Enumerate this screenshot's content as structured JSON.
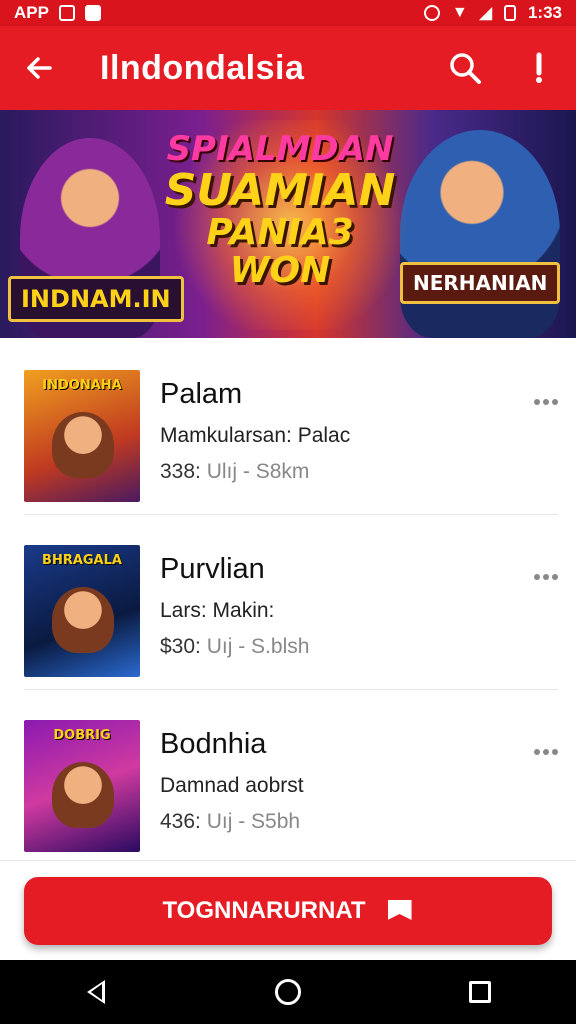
{
  "status_bar": {
    "left_text": "APP",
    "time": "1:33"
  },
  "app_bar": {
    "title": "Ilndondalsia",
    "back_icon": "arrow-left-icon",
    "search_icon": "search-icon",
    "more_icon": "exclamation-icon"
  },
  "banner": {
    "headline_line1": "SPIALMDAN",
    "headline_line2": "SUAMIAN",
    "headline_line3": "PANIA3 WON",
    "left_plate": "INDNAM.IN",
    "right_plate": "NERHANIAN"
  },
  "list": {
    "items": [
      {
        "thumb_caption": "INDONAHA",
        "name": "Palam",
        "description": "Mamkularsan: Palac",
        "price": "338:",
        "price_rest": "Ulıj - S8km"
      },
      {
        "thumb_caption": "BHRAGALA",
        "name": "Purvlian",
        "description": "Lars: Makin:",
        "price": "$30:",
        "price_rest": "Uıj - S.blsh"
      },
      {
        "thumb_caption": "DOBRIG",
        "name": "Bodnhia",
        "description": "Damnad aobrst",
        "price": "436:",
        "price_rest": "Uıj - S5bh"
      }
    ]
  },
  "cta": {
    "label": "TOGNNARURNAT",
    "icon": "flag-icon"
  },
  "colors": {
    "primary": "#e51c23",
    "status_bar": "#d9141c",
    "nav_bar": "#000000"
  }
}
